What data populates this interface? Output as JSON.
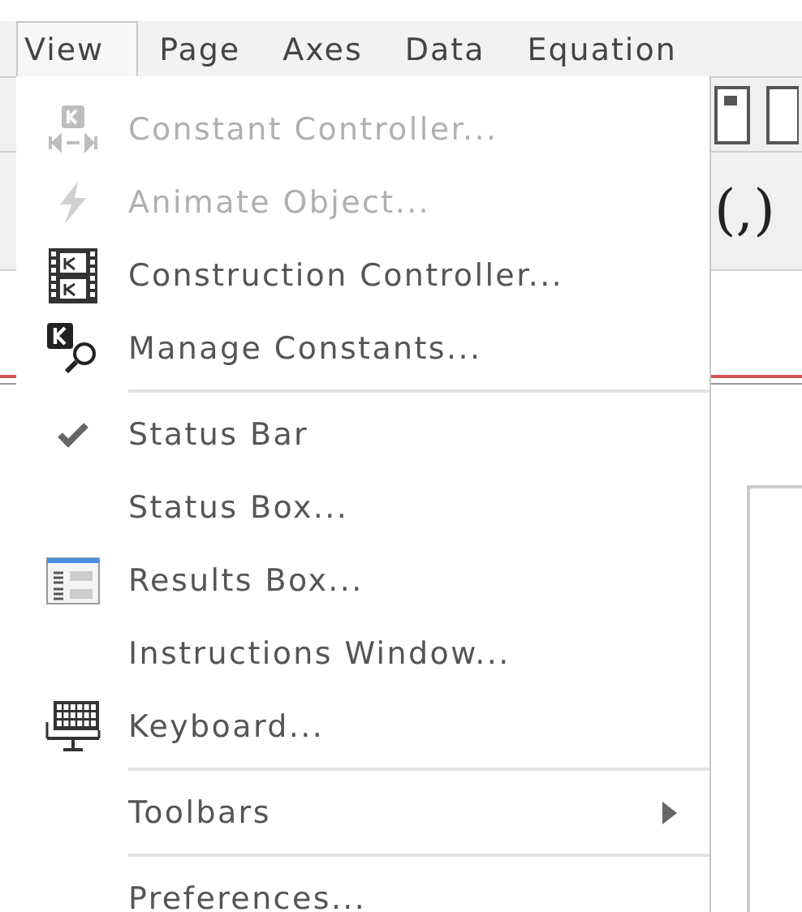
{
  "menubar": [
    {
      "label": "View",
      "selected": true
    },
    {
      "label": "Page",
      "selected": false
    },
    {
      "label": "Axes",
      "selected": false
    },
    {
      "label": "Data",
      "selected": false
    },
    {
      "label": "Equation",
      "selected": false
    }
  ],
  "toolbar_symbol": "(,)",
  "menu": [
    {
      "kind": "item",
      "label": "Constant Controller...",
      "disabled": true,
      "checked": false
    },
    {
      "kind": "item",
      "label": "Animate Object...",
      "disabled": true,
      "checked": false
    },
    {
      "kind": "item",
      "label": "Construction Controller...",
      "disabled": false,
      "checked": false
    },
    {
      "kind": "item",
      "label": "Manage Constants...",
      "disabled": false,
      "checked": false
    },
    {
      "kind": "separator"
    },
    {
      "kind": "item",
      "label": "Status Bar",
      "disabled": false,
      "checked": true
    },
    {
      "kind": "item",
      "label": "Status Box...",
      "disabled": false,
      "checked": false
    },
    {
      "kind": "item",
      "label": "Results Box...",
      "disabled": false,
      "checked": false
    },
    {
      "kind": "item",
      "label": "Instructions Window...",
      "disabled": false,
      "checked": false
    },
    {
      "kind": "item",
      "label": "Keyboard...",
      "disabled": false,
      "checked": false
    },
    {
      "kind": "separator"
    },
    {
      "kind": "submenu",
      "label": "Toolbars",
      "disabled": false
    },
    {
      "kind": "separator"
    },
    {
      "kind": "item",
      "label": "Preferences...",
      "disabled": false,
      "checked": false
    }
  ]
}
